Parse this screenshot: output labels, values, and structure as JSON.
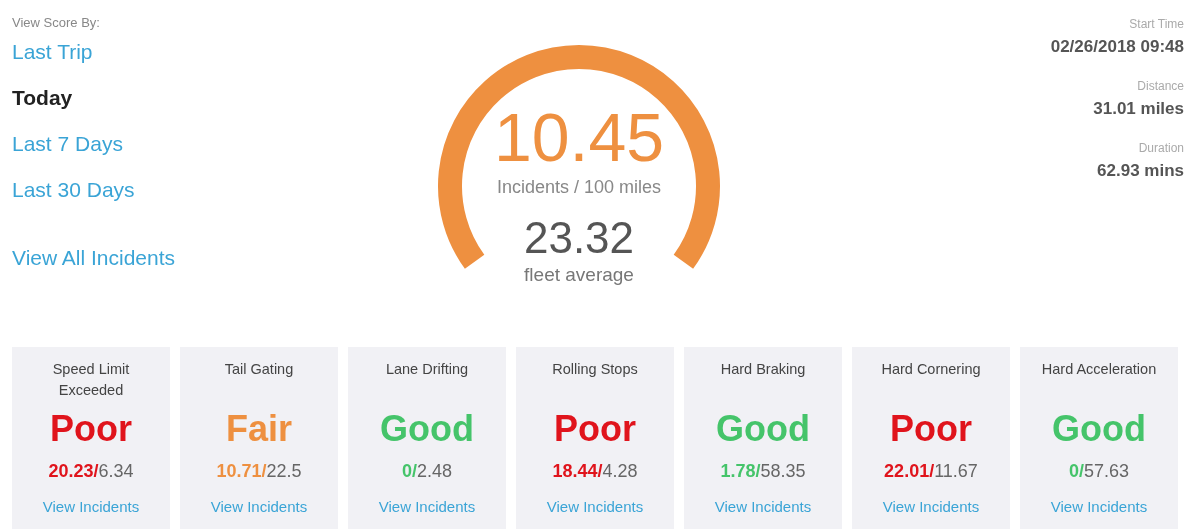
{
  "view_score_by": {
    "label": "View Score By:",
    "periods": [
      {
        "label": "Last Trip",
        "selected": false
      },
      {
        "label": "Today",
        "selected": true
      },
      {
        "label": "Last 7 Days",
        "selected": false
      },
      {
        "label": "Last 30 Days",
        "selected": false
      }
    ],
    "all_incidents_link": "View All Incidents"
  },
  "score": {
    "value": "10.45",
    "unit": "Incidents / 100 miles",
    "fleet_value": "23.32",
    "fleet_label": "fleet average"
  },
  "trip": [
    {
      "label": "Start Time",
      "value": "02/26/2018 09:48"
    },
    {
      "label": "Distance",
      "value": "31.01 miles"
    },
    {
      "label": "Duration",
      "value": "62.93 mins"
    }
  ],
  "categories": [
    {
      "title": "Speed Limit Exceeded",
      "kind": "poor",
      "rating": "Poor",
      "score": "20.23/",
      "fleet": "6.34",
      "link": "View Incidents"
    },
    {
      "title": "Tail Gating",
      "kind": "fair",
      "rating": "Fair",
      "score": "10.71/",
      "fleet": "22.5",
      "link": "View Incidents"
    },
    {
      "title": "Lane Drifting",
      "kind": "good",
      "rating": "Good",
      "score": "0/",
      "fleet": "2.48",
      "link": "View Incidents"
    },
    {
      "title": "Rolling Stops",
      "kind": "poor",
      "rating": "Poor",
      "score": "18.44/",
      "fleet": "4.28",
      "link": "View Incidents"
    },
    {
      "title": "Hard Braking",
      "kind": "good",
      "rating": "Good",
      "score": "1.78/",
      "fleet": "58.35",
      "link": "View Incidents"
    },
    {
      "title": "Hard Cornering",
      "kind": "poor",
      "rating": "Poor",
      "score": "22.01/",
      "fleet": "11.67",
      "link": "View Incidents"
    },
    {
      "title": "Hard Acceleration",
      "kind": "good",
      "rating": "Good",
      "score": "0/",
      "fleet": "57.63",
      "link": "View Incidents"
    }
  ]
}
